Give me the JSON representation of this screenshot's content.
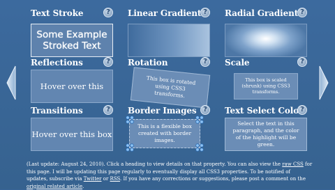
{
  "colors": {
    "background": "#386496",
    "box": "#6b8db6",
    "text": "#ffffff"
  },
  "nav": {
    "prev_icon": "chevron-left-icon",
    "next_icon": "chevron-right-icon"
  },
  "help_label": "?",
  "cells": {
    "text_stroke": {
      "heading": "Text Stroke",
      "sample": "Some Example Stroked Text"
    },
    "linear_gradients": {
      "heading": "Linear Gradients"
    },
    "radial_gradients": {
      "heading": "Radial Gradients"
    },
    "reflections": {
      "heading": "Reflections",
      "sample": "Hover over this"
    },
    "rotation": {
      "heading": "Rotation",
      "sample": "This box is rotated using CSS3 transforms."
    },
    "scale": {
      "heading": "Scale",
      "sample": "This box is scaled (shrunk) using CSS3 transforms."
    },
    "transitions": {
      "heading": "Transitions",
      "sample": "Hover over this box"
    },
    "border_images": {
      "heading": "Border Images",
      "sample": "This is a flexible box created with border images."
    },
    "text_select_color": {
      "heading": "Text Select Color",
      "sample": "Select the text in this paragraph, and the color of the highlight will be green."
    }
  },
  "footer": {
    "part1": "(Last update: August 24, 2010). Click a heading to view details on that property. You can also view the ",
    "link_raw_css": "raw CSS",
    "part2": " for this page. I will be updating this page regularly to eventually display all CSS3 properties. To be notified of updates, subscribe via ",
    "link_twitter": "Twitter",
    "part3": " or ",
    "link_rss": "RSS",
    "part4": ". If you have any corrections or suggestions, please post a comment on the ",
    "link_article": "original related article",
    "part5": "."
  }
}
